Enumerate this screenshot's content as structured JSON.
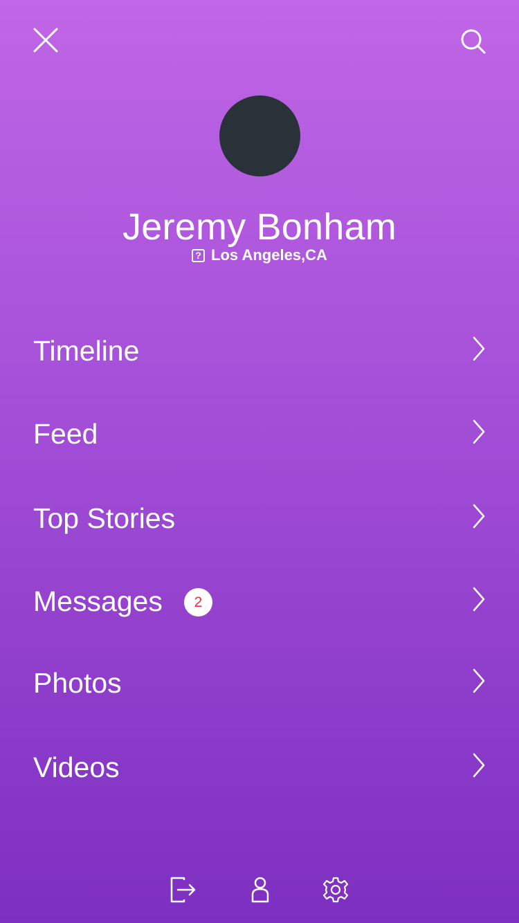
{
  "header": {
    "close_icon": "close-icon",
    "search_icon": "search-icon"
  },
  "profile": {
    "name": "Jeremy Bonham",
    "location_icon": "location-icon",
    "location_icon_glyph": "?",
    "location": "Los Angeles,CA"
  },
  "menu": {
    "items": [
      {
        "label": "Timeline",
        "badge": null
      },
      {
        "label": "Feed",
        "badge": null
      },
      {
        "label": "Top Stories",
        "badge": null
      },
      {
        "label": "Messages",
        "badge": "2"
      },
      {
        "label": "Photos",
        "badge": null
      },
      {
        "label": "Videos",
        "badge": null
      }
    ]
  },
  "bottom_bar": {
    "icons": [
      "logout-icon",
      "profile-icon",
      "settings-icon"
    ]
  },
  "colors": {
    "gradient_top": "#c066e6",
    "gradient_bottom": "#7d2fc1",
    "avatar": "#283238",
    "badge_text": "#ee2c42",
    "foreground": "#ffffff"
  }
}
